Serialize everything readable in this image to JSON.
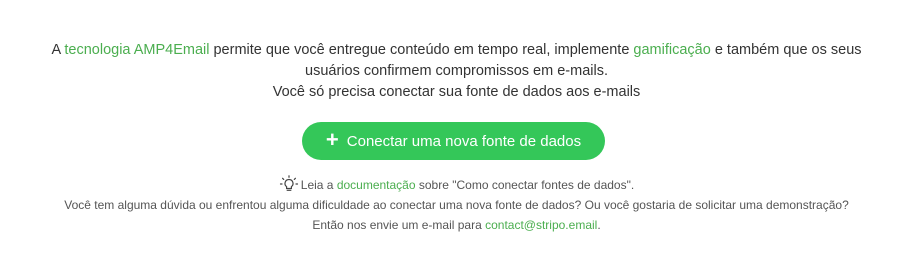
{
  "intro": {
    "part1": "A ",
    "link_tech": "tecnologia AMP4Email",
    "part2": " permite que você entregue conteúdo em tempo real, implemente ",
    "link_gamification": "gamificação",
    "part3": " e também que os seus",
    "line2": "usuários confirmem compromissos em e-mails.",
    "line3": "Você só precisa conectar sua fonte de dados aos e-mails"
  },
  "connect_button": {
    "icon": "plus-icon",
    "label": "Conectar uma nova fonte de dados"
  },
  "help": {
    "icon": "lightbulb-icon",
    "read_prefix": "Leia a ",
    "docs_link": "documentação",
    "read_suffix": " sobre \"Como conectar fontes de dados\".",
    "question": "Você tem alguma dúvida ou enfrentou alguma dificuldade ao conectar uma nova fonte de dados? Ou você gostaria de solicitar uma demonstração?",
    "contact_prefix": "Então nos envie um e-mail para ",
    "contact_email": "contact@stripo.email",
    "contact_suffix": "."
  },
  "colors": {
    "accent_link": "#4bae4f",
    "button_bg": "#34c759",
    "text": "#333333"
  }
}
